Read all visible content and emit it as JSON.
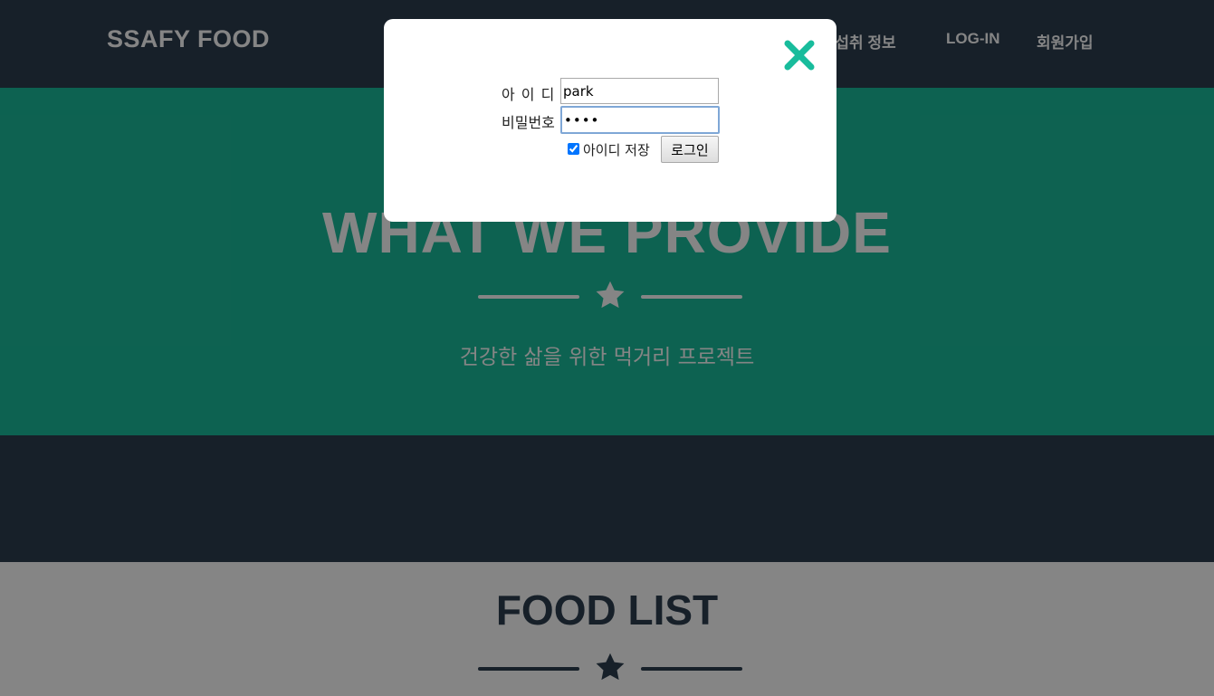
{
  "navbar": {
    "brand": "SSAFY FOOD",
    "links": [
      {
        "label": "내 섭취 정보"
      },
      {
        "label": "LOG-IN"
      },
      {
        "label": "회원가입"
      }
    ]
  },
  "hero": {
    "title": "WHAT WE PROVIDE",
    "subtitle": "건강한 삶을 위한 먹거리 프로젝트",
    "star_icon": "star-icon"
  },
  "food_list": {
    "title": "FOOD LIST",
    "star_icon": "star-icon"
  },
  "login_modal": {
    "close_icon": "close-icon",
    "id_label": "아 이 디",
    "id_value": "park",
    "password_label": "비밀번호",
    "password_value": "pass",
    "remember_label": "아이디 저장",
    "remember_checked": true,
    "login_button": "로그인"
  },
  "colors": {
    "navbar": "#2c3e50",
    "hero": "#1abc9c",
    "accent": "#18bc9c",
    "overlay": "rgba(0,0,0,0.48)"
  }
}
